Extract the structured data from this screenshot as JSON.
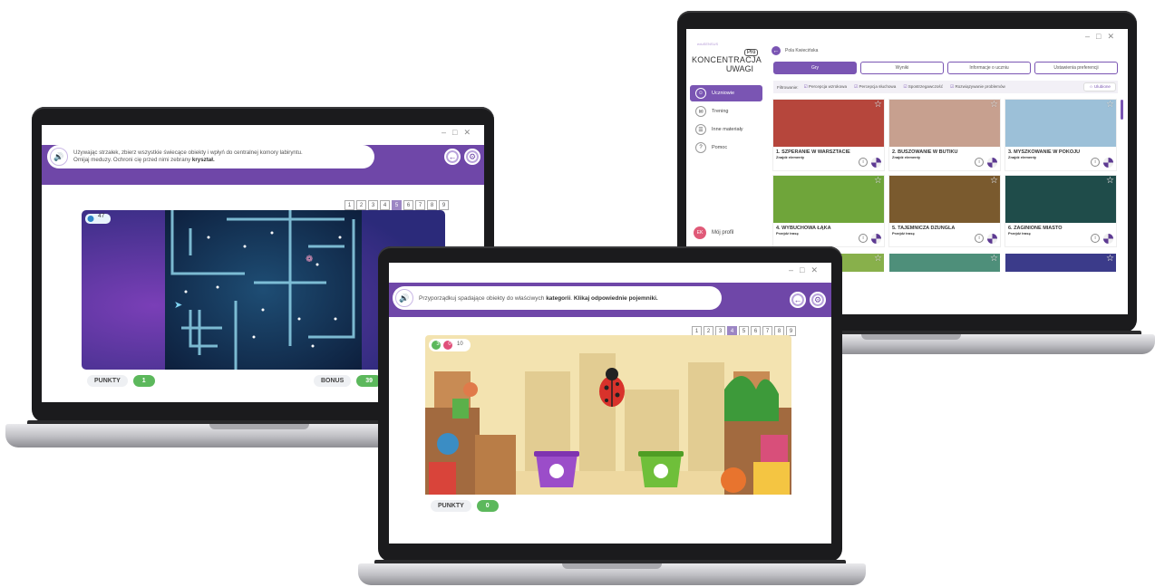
{
  "left_laptop": {
    "instruction_plain": "Używając strzałek, zbierz wszystkie świecące obiekty i wpłyń do centralnej komory labiryntu.",
    "instruction_plain_2": "Omijaj meduzy. Ochroni cię przed nimi zebrany ",
    "instruction_bold": "kryształ.",
    "levels": [
      "1",
      "2",
      "3",
      "4",
      "5",
      "6",
      "7",
      "8",
      "9"
    ],
    "active_level": 5,
    "counter": "47",
    "punkty_label": "PUNKTY",
    "punkty_value": "1",
    "bonus_label": "BONUS",
    "bonus_value": "39"
  },
  "center_laptop": {
    "instruction_plain": "Przyporządkuj spadające obiekty do właściwych ",
    "instruction_bold_1": "kategorii",
    "instruction_plain_2": ". ",
    "instruction_bold_2": "Klikaj odpowiednie pojemniki.",
    "levels": [
      "1",
      "2",
      "3",
      "4",
      "5",
      "6",
      "7",
      "8",
      "9"
    ],
    "active_level": 4,
    "score_green": "3",
    "score_red": "0",
    "score_total": "10",
    "punkty_label": "PUNKTY",
    "punkty_value": "0"
  },
  "right_laptop": {
    "logo_small": "eduSENSUS",
    "logo_pro": "Pro",
    "logo_line1": "KONCENTRACJA",
    "logo_line2": "UWAGI",
    "sidebar": [
      {
        "label": "Uczniowie",
        "icon": "user-icon",
        "active": true
      },
      {
        "label": "Trening",
        "icon": "chat-icon",
        "active": false
      },
      {
        "label": "Inne materiały",
        "icon": "folder-icon",
        "active": false
      },
      {
        "label": "Pomoc",
        "icon": "question-icon",
        "active": false
      }
    ],
    "profile_initials": "EK",
    "profile_label": "Mój profil",
    "back_label": "Pola Kwiecińska",
    "tabs": [
      "Gry",
      "Wyniki",
      "Informacje o uczniu",
      "Ustawienia preferencji"
    ],
    "filter_label": "Filtrowanie:",
    "filters": [
      "Percepcja wzrokowa",
      "Percepcja słuchowa",
      "Spostrzegawczość",
      "Rozwiązywanie problemów"
    ],
    "favorites_label": "Ulubione",
    "games": [
      {
        "title": "1. SZPERANIE W WARSZTACIE",
        "subtitle": "Znajdź elementy",
        "color": "#b6463c"
      },
      {
        "title": "2. BUSZOWANIE W BUTIKU",
        "subtitle": "Znajdź elementy",
        "color": "#c7a08f"
      },
      {
        "title": "3. MYSZKOWANIE W POKOJU",
        "subtitle": "Znajdź elementy",
        "color": "#9cc0d8"
      },
      {
        "title": "4. WYBUCHOWA ŁĄKA",
        "subtitle": "Przejdź trasę",
        "color": "#6fa53a"
      },
      {
        "title": "5. TAJEMNICZA DŻUNGLA",
        "subtitle": "Przejdź trasę",
        "color": "#7a5a2e"
      },
      {
        "title": "6. ZAGINIONE MIASTO",
        "subtitle": "Przejdź trasę",
        "color": "#1f4c4a"
      }
    ],
    "row3_colors": [
      "#88b04b",
      "#4e8f7a",
      "#3b3b8a"
    ]
  }
}
